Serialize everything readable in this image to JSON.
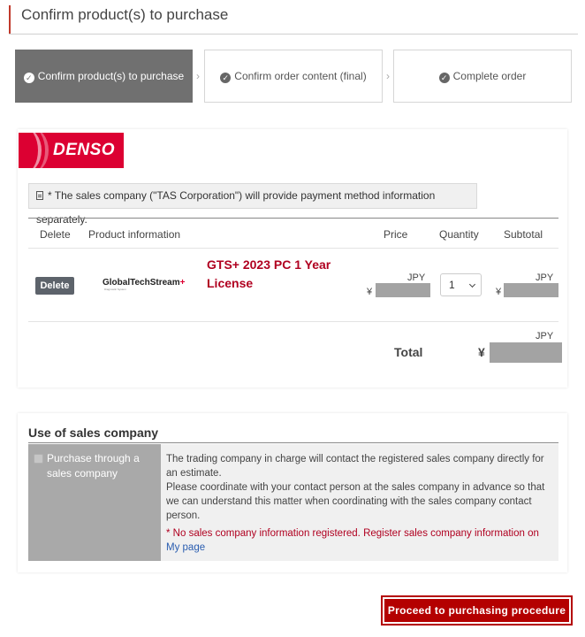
{
  "page": {
    "title": "Confirm product(s) to purchase"
  },
  "steps": [
    {
      "label": "Confirm product(s) to purchase",
      "state": "active"
    },
    {
      "label": "Confirm order content (final)",
      "state": "pending"
    },
    {
      "label": "Complete order",
      "state": "pending"
    }
  ],
  "brand": {
    "logo_text": "DENSO",
    "color": "#dc0032"
  },
  "notice": "* The sales company (\"TAS Corporation\") will provide payment method information separately.",
  "table": {
    "headers": {
      "delete": "Delete",
      "product": "Product information",
      "price": "Price",
      "quantity": "Quantity",
      "subtotal": "Subtotal"
    },
    "rows": [
      {
        "delete_label": "Delete",
        "product_logo": {
          "main": "GlobalTechStream",
          "plus": "+",
          "sub": "Diagnostic System"
        },
        "product_name": "GTS+ 2023 PC 1 Year License",
        "currency": "JPY",
        "currency_symbol": "¥",
        "quantity": "1"
      }
    ],
    "total": {
      "label": "Total",
      "currency": "JPY",
      "currency_symbol": "¥"
    }
  },
  "sales_company": {
    "title": "Use of sales company",
    "checkbox_label": "Purchase through a sales company",
    "description": "The trading company in charge will contact the registered sales company directly for an estimate.\nPlease coordinate with your contact person at the sales company in advance so that we can understand this matter when coordinating with the sales company contact person.",
    "warning": "* No sales company information registered. Register sales company information on",
    "warning_link": "My page"
  },
  "actions": {
    "proceed": "Proceed to purchasing procedure"
  },
  "colors": {
    "accent": "#b40000",
    "step_active": "#707070"
  }
}
